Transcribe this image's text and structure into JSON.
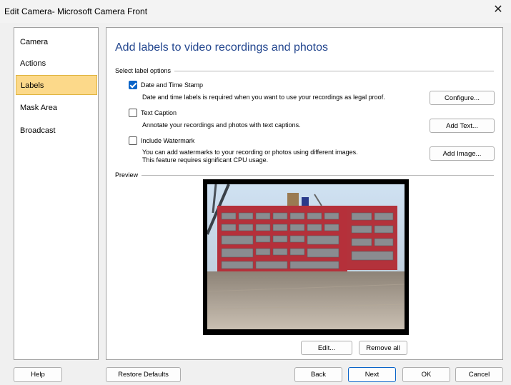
{
  "window": {
    "title": "Edit Camera- Microsoft Camera Front",
    "close_glyph": "✕"
  },
  "nav": {
    "items": [
      {
        "label": "Camera"
      },
      {
        "label": "Actions"
      },
      {
        "label": "Labels",
        "selected": true
      },
      {
        "label": "Mask Area"
      },
      {
        "label": "Broadcast"
      }
    ]
  },
  "page": {
    "heading": "Add labels to video recordings and photos",
    "section_label_options": "Select label options",
    "section_preview": "Preview"
  },
  "options": [
    {
      "label": "Date and Time Stamp",
      "checked": true,
      "desc": "Date and time labels is required when you want to use your recordings as legal proof.",
      "button": "Configure..."
    },
    {
      "label": "Text Caption",
      "checked": false,
      "desc": "Annotate your recordings and photos with text captions.",
      "button": "Add Text..."
    },
    {
      "label": "Include Watermark",
      "checked": false,
      "desc_line1": "You can add watermarks to your recording or photos using different images.",
      "desc_line2": "This feature requires significant CPU usage.",
      "button": "Add Image..."
    }
  ],
  "preview_buttons": {
    "edit": "Edit...",
    "remove_all": "Remove all"
  },
  "footer": {
    "help": "Help",
    "restore": "Restore Defaults",
    "back": "Back",
    "next": "Next",
    "ok": "OK",
    "cancel": "Cancel"
  },
  "colors": {
    "accent": "#0a64c8",
    "heading": "#24478f",
    "nav_selected": "#fcd98a"
  }
}
